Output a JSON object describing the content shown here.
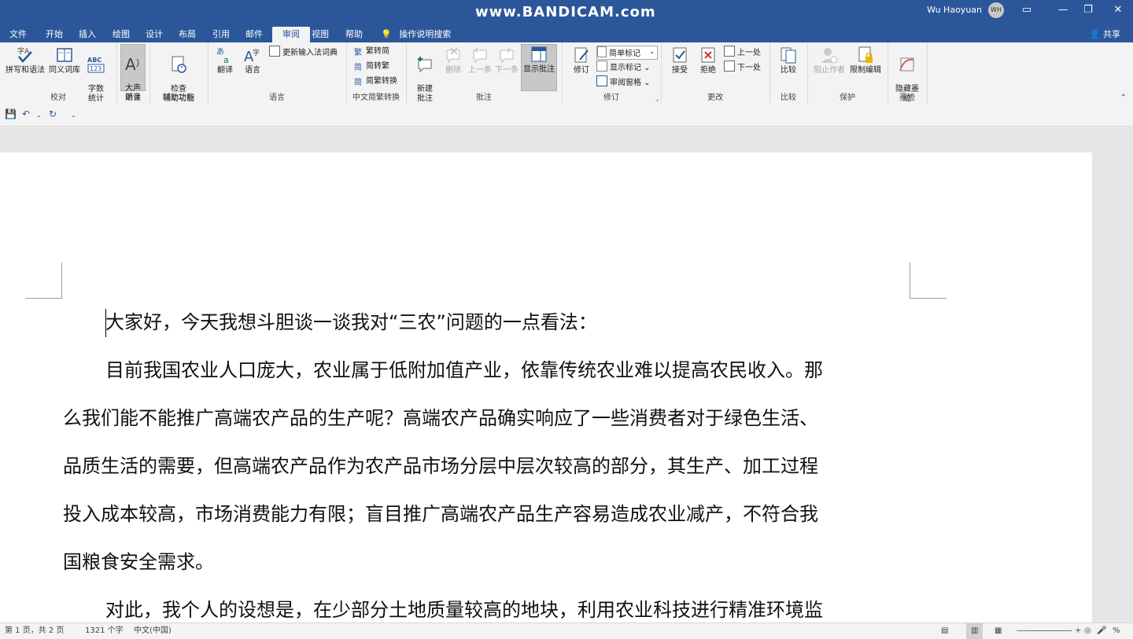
{
  "watermark": "www.BANDICAM.com",
  "user": {
    "name": "Wu Haoyuan",
    "initials": "WH"
  },
  "window_controls": [
    "ribbon-display-icon",
    "minimize-icon",
    "restore-icon",
    "close-icon"
  ],
  "tabs": [
    {
      "label": "文件"
    },
    {
      "label": "开始"
    },
    {
      "label": "插入"
    },
    {
      "label": "绘图"
    },
    {
      "label": "设计"
    },
    {
      "label": "布局"
    },
    {
      "label": "引用"
    },
    {
      "label": "邮件"
    },
    {
      "label": "审阅",
      "active": true
    },
    {
      "label": "视图"
    },
    {
      "label": "帮助"
    }
  ],
  "tell_me": "操作说明搜索",
  "share": "共享",
  "ribbon": {
    "proofing": {
      "label": "校对",
      "spelling": "拼写和语法",
      "thesaurus": "同义词库",
      "wordcount": "字数\n统计"
    },
    "speech": {
      "label": "语音",
      "read_aloud": "大声\n朗读"
    },
    "accessibility": {
      "label": "辅助功能",
      "check": "检查\n辅助功能"
    },
    "language": {
      "label": "语言",
      "translate": "翻译",
      "language": "语言",
      "update_ime": "更新输入法词典"
    },
    "chinese": {
      "label": "中文简繁转换",
      "to_simplified": "繁转简",
      "to_traditional": "简转繁",
      "convert": "简繁转换"
    },
    "comments": {
      "label": "批注",
      "new": "新建\n批注",
      "delete": "删除",
      "prev": "上一条",
      "next": "下一条",
      "show": "显示批注"
    },
    "tracking": {
      "label": "修订",
      "track": "修订",
      "markup_select": "简单标记",
      "show_markup": "显示标记",
      "pane": "审阅窗格"
    },
    "changes": {
      "label": "更改",
      "accept": "接受",
      "reject": "拒绝",
      "prev": "上一处",
      "next": "下一处"
    },
    "compare": {
      "label": "比较",
      "compare": "比较"
    },
    "protect": {
      "label": "保护",
      "block": "阻止作者",
      "restrict": "限制编辑"
    },
    "ink": {
      "label": "墨迹",
      "hide": "隐藏墨\n迹"
    }
  },
  "document": {
    "paragraphs": [
      "大家好，今天我想斗胆谈一谈我对“三农”问题的一点看法：",
      "目前我国农业人口庞大，农业属于低附加值产业，依靠传统农业难以提高农民收入。那",
      "么我们能不能推广高端农产品的生产呢？高端农产品确实响应了一些消费者对于绿色生活、",
      "品质生活的需要，但高端农产品作为农产品市场分层中层次较高的部分，其生产、加工过程",
      "投入成本较高，市场消费能力有限；盲目推广高端农产品生产容易造成农业减产，不符合我",
      "国粮食安全需求。",
      "对此，我个人的设想是，在少部分土地质量较高的地块，利用农业科技进行精准环境监"
    ]
  },
  "status": {
    "page": "第 1 页，共 2 页",
    "words": "1321 个字",
    "lang": "中文(中国)",
    "zoom": "%"
  }
}
